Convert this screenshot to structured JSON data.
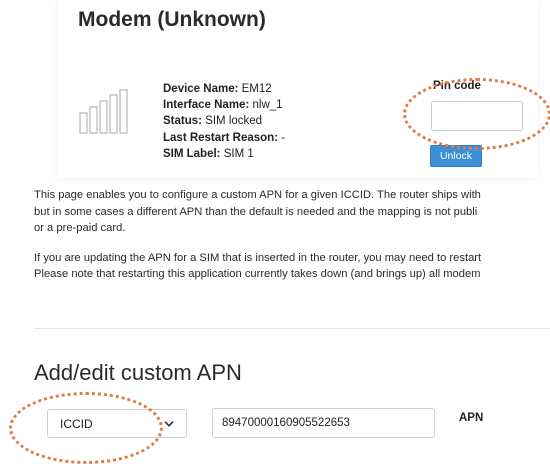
{
  "modem": {
    "title": "Modem (Unknown)",
    "signal_icon": "signal-bars-icon",
    "info": [
      {
        "key": "Device Name:",
        "value": "EM12"
      },
      {
        "key": "Interface Name:",
        "value": "nlw_1"
      },
      {
        "key": "Status:",
        "value": "SIM locked"
      },
      {
        "key": "Last Restart Reason:",
        "value": "-"
      },
      {
        "key": "SIM Label:",
        "value": "SIM 1"
      }
    ],
    "pin_label": "Pin code",
    "pin_value": "",
    "unlock_label": "Unlock"
  },
  "description": {
    "paragraph1": [
      "This page enables you to configure a custom APN for a given ICCID. The router ships with",
      "but in some cases a different APN than the default is needed and the mapping is not publi",
      "or a pre-paid card."
    ],
    "paragraph2": [
      "If you are updating the APN for a SIM that is inserted in the router, you may need to restart",
      "Please note that restarting this application currently takes down (and brings up) all modem"
    ]
  },
  "apn_form": {
    "heading": "Add/edit custom APN",
    "select_value": "ICCID",
    "iccid_value": "89470000160905522653",
    "apn_label": "APN"
  },
  "colors": {
    "accent": "#3d8fd9",
    "callout": "#e27a43"
  },
  "icons": {
    "dropdown": "chevron-down-icon"
  }
}
